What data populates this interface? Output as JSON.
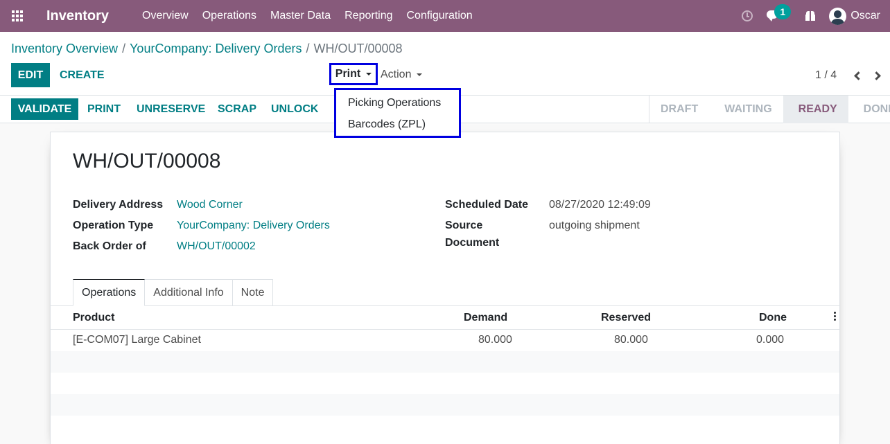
{
  "navbar": {
    "brand": "Inventory",
    "menu": [
      "Overview",
      "Operations",
      "Master Data",
      "Reporting",
      "Configuration"
    ],
    "chat_count": "1",
    "user": "Oscar",
    "color": "#875a7b"
  },
  "breadcrumb": {
    "items": [
      "Inventory Overview",
      "YourCompany: Delivery Orders"
    ],
    "sep": "/",
    "current": "WH/OUT/00008"
  },
  "toolbar": {
    "edit": "EDIT",
    "create": "CREATE",
    "print": "Print",
    "action": "Action",
    "pager": "1 / 4"
  },
  "print_menu": {
    "items": [
      "Picking Operations",
      "Barcodes (ZPL)"
    ]
  },
  "buttons": {
    "validate": "VALIDATE",
    "print": "PRINT",
    "unreserve": "UNRESERVE",
    "scrap": "SCRAP",
    "unlock": "UNLOCK"
  },
  "status": {
    "stages": [
      "DRAFT",
      "WAITING",
      "READY",
      "DONE"
    ],
    "current": "READY"
  },
  "record": {
    "title": "WH/OUT/00008",
    "delivery_address_label": "Delivery Address",
    "delivery_address": "Wood Corner",
    "operation_type_label": "Operation Type",
    "operation_type": "YourCompany: Delivery Orders",
    "back_order_label": "Back Order of",
    "back_order": "WH/OUT/00002",
    "scheduled_date_label": "Scheduled Date",
    "scheduled_date": "08/27/2020 12:49:09",
    "source_label_1": "Source",
    "source_label_2": "Document",
    "source_document": "outgoing shipment"
  },
  "tabs": [
    "Operations",
    "Additional Info",
    "Note"
  ],
  "table": {
    "columns": [
      "Product",
      "Demand",
      "Reserved",
      "Done"
    ],
    "rows": [
      {
        "product": "[E-COM07] Large Cabinet",
        "demand": "80.000",
        "reserved": "80.000",
        "done": "0.000"
      }
    ]
  }
}
